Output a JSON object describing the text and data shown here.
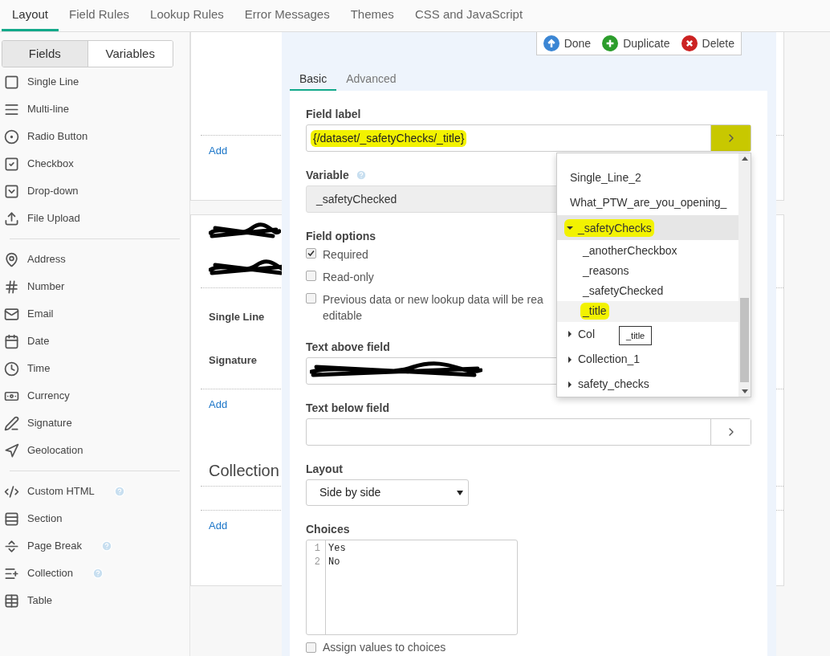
{
  "top_tabs": [
    {
      "label": "Layout",
      "selected": true
    },
    {
      "label": "Field Rules",
      "selected": false
    },
    {
      "label": "Lookup Rules",
      "selected": false
    },
    {
      "label": "Error Messages",
      "selected": false
    },
    {
      "label": "Themes",
      "selected": false
    },
    {
      "label": "CSS and JavaScript",
      "selected": false
    }
  ],
  "sidebar": {
    "toggle": [
      {
        "label": "Fields",
        "selected": true
      },
      {
        "label": "Variables",
        "selected": false
      }
    ],
    "groups": [
      [
        {
          "label": "Single Line",
          "help": false
        },
        {
          "label": "Multi-line",
          "help": false
        },
        {
          "label": "Radio Button",
          "help": false
        },
        {
          "label": "Checkbox",
          "help": false
        },
        {
          "label": "Drop-down",
          "help": false
        },
        {
          "label": "File Upload",
          "help": false
        }
      ],
      [
        {
          "label": "Address",
          "help": false
        },
        {
          "label": "Number",
          "help": false
        },
        {
          "label": "Email",
          "help": false
        },
        {
          "label": "Date",
          "help": false
        },
        {
          "label": "Time",
          "help": false
        },
        {
          "label": "Currency",
          "help": false
        },
        {
          "label": "Signature",
          "help": false
        },
        {
          "label": "Geolocation",
          "help": false
        }
      ],
      [
        {
          "label": "Custom HTML",
          "help": true
        },
        {
          "label": "Section",
          "help": false
        },
        {
          "label": "Page Break",
          "help": true
        },
        {
          "label": "Collection",
          "help": true
        },
        {
          "label": "Table",
          "help": false
        }
      ]
    ]
  },
  "canvas": {
    "card_1": {
      "add_link": "Add"
    },
    "card_2": {
      "fields": [
        "Single Line",
        "Signature"
      ],
      "add_link": "Add",
      "collection_title": "Collection",
      "collection_add_link": "Add"
    }
  },
  "editor": {
    "actions": [
      {
        "kind": "done",
        "label": "Done"
      },
      {
        "kind": "duplicate",
        "label": "Duplicate"
      },
      {
        "kind": "delete",
        "label": "Delete"
      }
    ],
    "tabs": [
      {
        "label": "Basic",
        "selected": true
      },
      {
        "label": "Advanced",
        "selected": false
      }
    ],
    "field_label": {
      "label": "Field label",
      "value": "{/dataset/_safetyChecks/_title}",
      "highlighted": true,
      "button_highlighted": true
    },
    "variable": {
      "label": "Variable",
      "value": "_safetyChecked"
    },
    "field_options": {
      "label": "Field options",
      "options": [
        {
          "lines": [
            "Required"
          ],
          "checked": true
        },
        {
          "lines": [
            "Read-only"
          ],
          "checked": false
        },
        {
          "lines": [
            "Previous data or new lookup data will be rea",
            "editable"
          ],
          "checked": false
        }
      ]
    },
    "text_above": {
      "label": "Text above field"
    },
    "text_below": {
      "label": "Text below field"
    },
    "layout": {
      "label": "Layout",
      "value": "Side by side"
    },
    "choices": {
      "label": "Choices",
      "lines": [
        {
          "number": "1",
          "text": "Yes"
        },
        {
          "number": "2",
          "text": "No"
        }
      ]
    },
    "assign_values": {
      "label": "Assign values to choices",
      "checked": false
    }
  },
  "dropdown": {
    "items": [
      {
        "label": "Single_Line_2",
        "highlighted": false
      },
      {
        "label": "What_PTW_are_you_opening_",
        "highlighted": false
      },
      {
        "label": "_safetyChecks",
        "expanded": true,
        "highlighted": true,
        "children": [
          {
            "label": "_anotherCheckbox",
            "highlighted": false,
            "hovered": false
          },
          {
            "label": "_reasons",
            "highlighted": false,
            "hovered": false
          },
          {
            "label": "_safetyChecked",
            "highlighted": false,
            "hovered": false
          },
          {
            "label": "_title",
            "highlighted": true,
            "hovered": true
          }
        ]
      },
      {
        "label": "Col",
        "expanded": false,
        "highlighted": false
      },
      {
        "label": "Collection_1",
        "expanded": false,
        "highlighted": false
      },
      {
        "label": "safety_checks",
        "expanded": false,
        "highlighted": false
      }
    ],
    "tooltip": "_title"
  }
}
